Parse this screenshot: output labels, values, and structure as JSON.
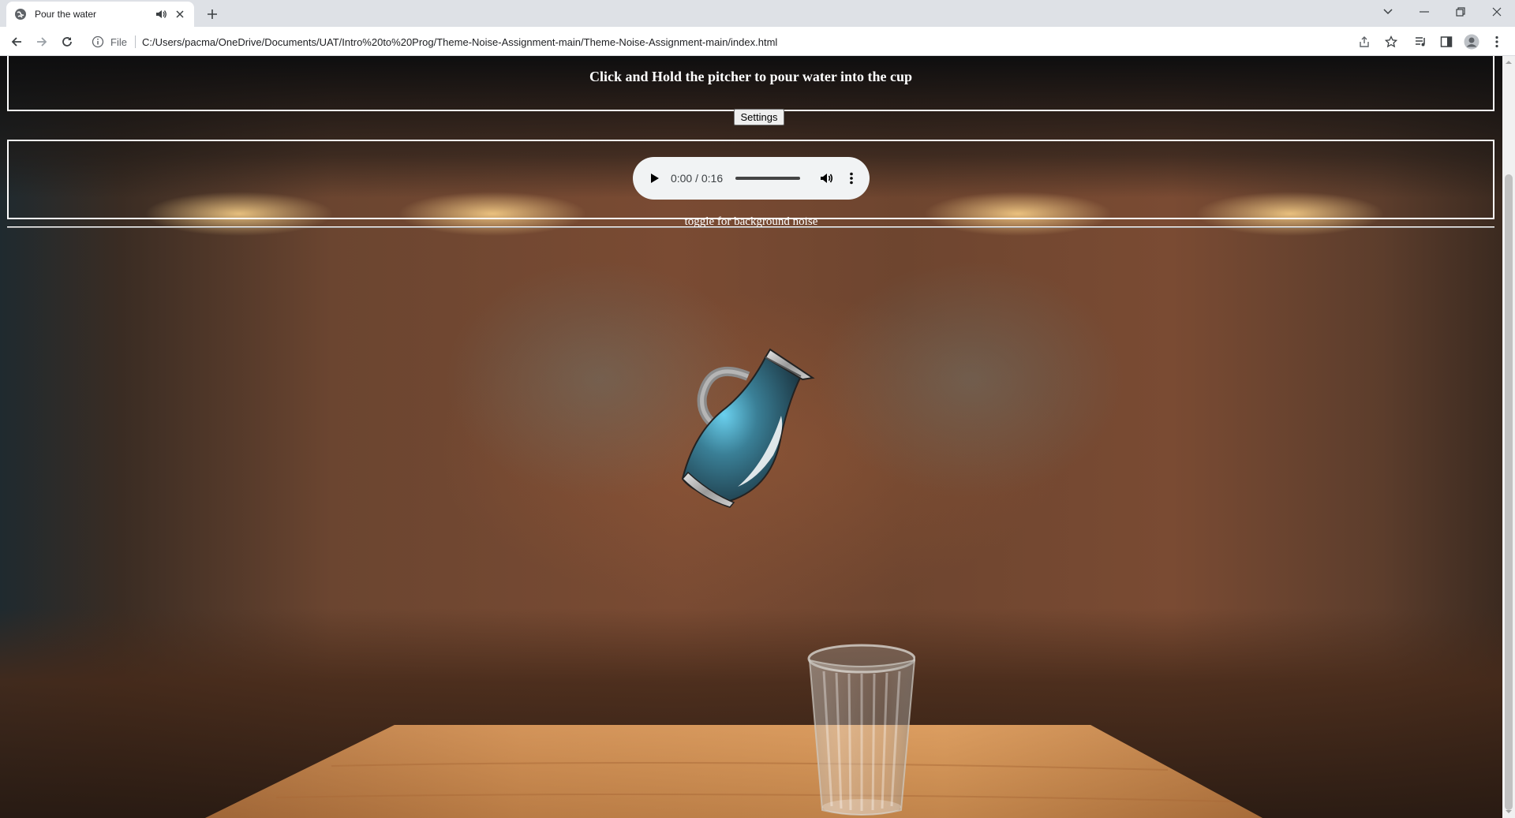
{
  "browser": {
    "tab_title": "Pour the water",
    "url_scheme_label": "File",
    "url": "C:/Users/pacma/OneDrive/Documents/UAT/Intro%20to%20Prog/Theme-Noise-Assignment-main/Theme-Noise-Assignment-main/index.html"
  },
  "page": {
    "instruction": "Click and Hold the pitcher to pour water into the cup",
    "settings_label": "Settings",
    "audio": {
      "time": "0:00 / 0:16",
      "progress": 0
    },
    "toggle_text": "toggle for background noise"
  }
}
